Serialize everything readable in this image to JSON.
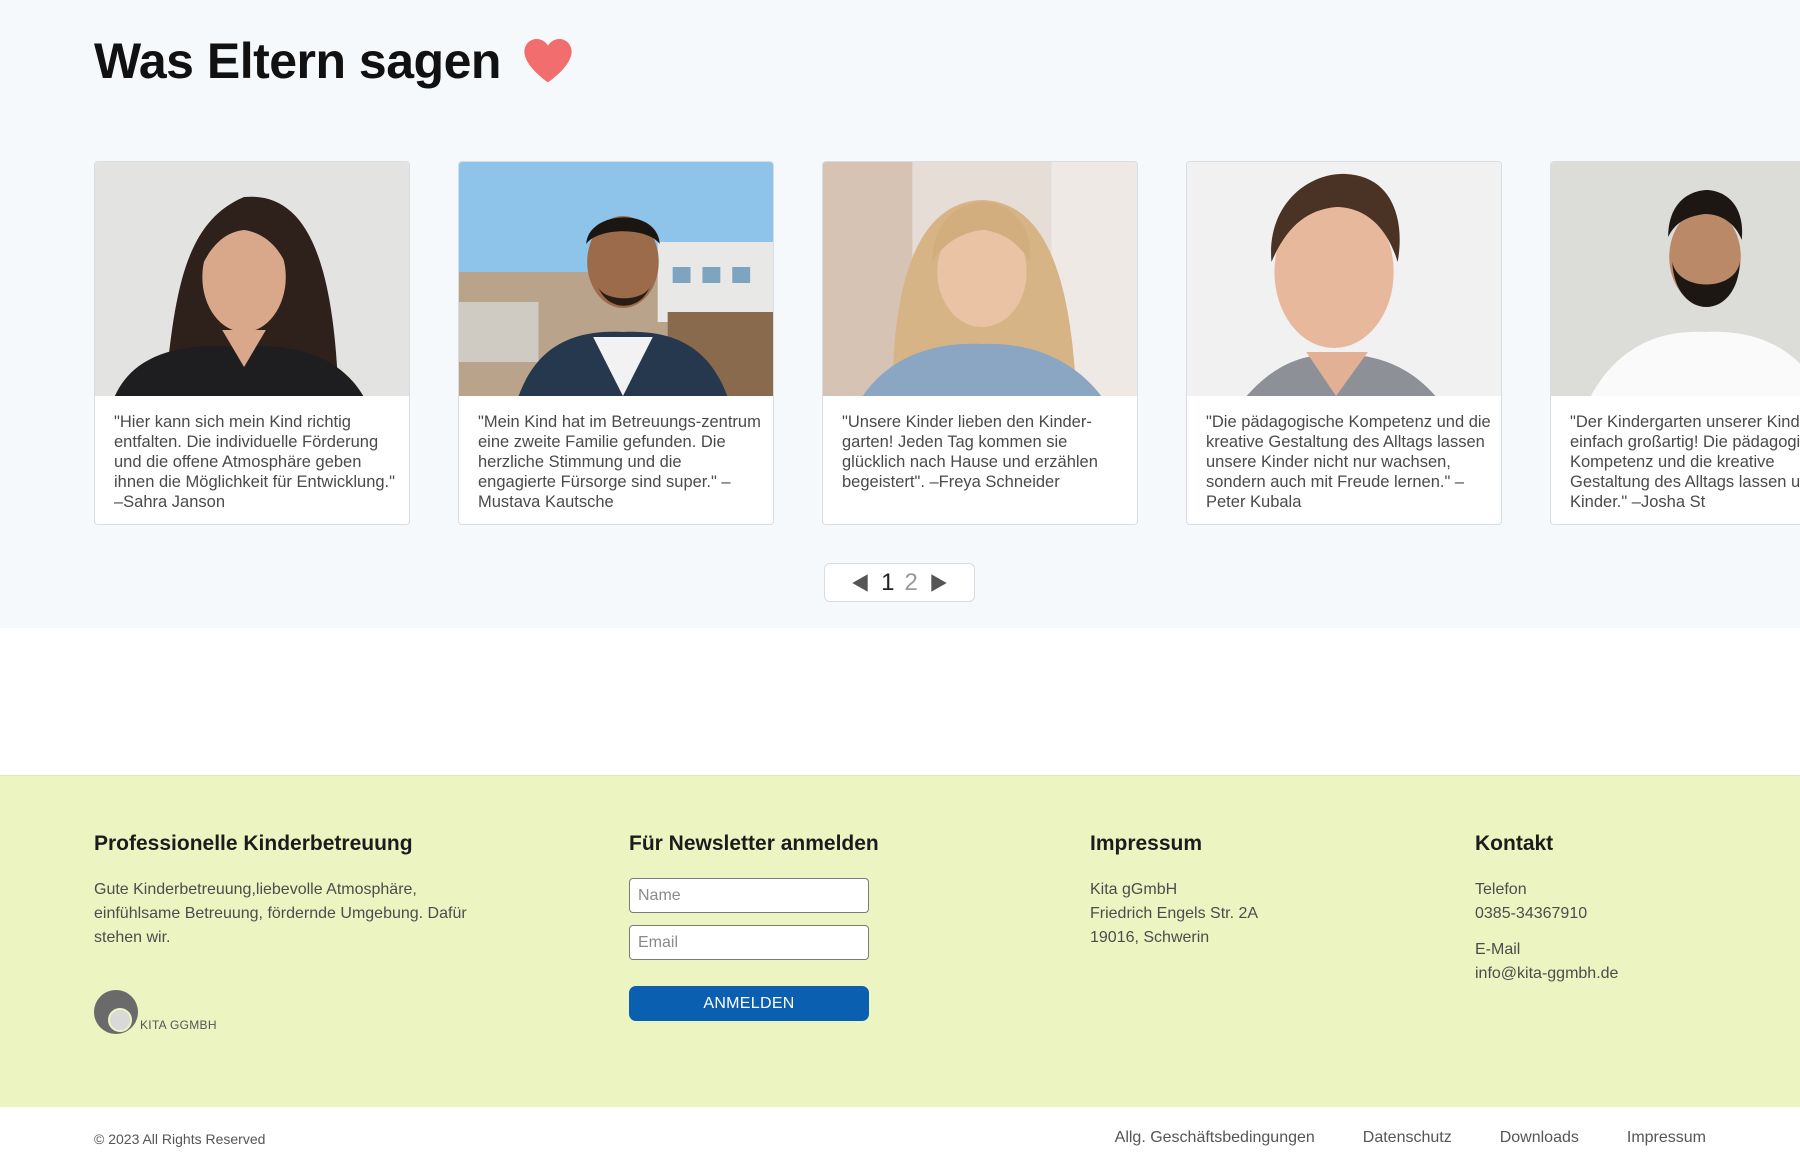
{
  "testimonials": {
    "heading": "Was Eltern sagen",
    "heart_icon": "heart-icon",
    "heart_color": "#f26d6d",
    "cards": [
      {
        "quote": "\"Hier kann sich mein Kind richtig entfalten. Die individuelle Förderung und die offene Atmosphäre geben ihnen die Möglichkeit für Entwicklung.\" –Sahra Janson"
      },
      {
        "quote": "\"Mein Kind hat im Betreuungs-zentrum eine zweite Familie gefunden. Die herzliche Stimmung und die engagierte Fürsorge sind super.\" – Mustava Kautsche"
      },
      {
        "quote": "\"Unsere Kinder lieben den Kinder-garten! Jeden Tag kommen sie glücklich nach Hause und erzählen begeistert\". –Freya Schneider"
      },
      {
        "quote": "\"Die pädagogische Kompetenz und die kreative Gestaltung des Alltags lassen unsere Kinder nicht nur wachsen, sondern auch mit Freude lernen.\" – Peter Kubala"
      },
      {
        "quote": "\"Der Kindergarten unserer Kinder ist einfach großartig! Die pädagogische Kompetenz und die kreative Gestaltung des Alltags lassen unsere Kinder.\" –Josha St"
      }
    ],
    "pager": {
      "prev_icon": "triangle-left-icon",
      "next_icon": "triangle-right-icon",
      "page_1": "1",
      "page_2": "2",
      "current_page": 1
    }
  },
  "footer": {
    "about": {
      "title": "Professionelle Kinderbetreuung",
      "text": "Gute Kinderbetreuung,liebevolle Atmosphäre, einfühlsame Betreuung, fördernde Umgebung. Dafür stehen wir.",
      "logo_text": "KITA GGMBH"
    },
    "newsletter": {
      "title": "Für Newsletter anmelden",
      "name_placeholder": "Name",
      "email_placeholder": "Email",
      "button_label": "ANMELDEN",
      "button_color": "#0b5fb0"
    },
    "impressum": {
      "title": "Impressum",
      "line1": "Kita gGmbH",
      "line2": "Friedrich Engels Str. 2A",
      "line3": "19016, Schwerin"
    },
    "kontakt": {
      "title": "Kontakt",
      "phone_label": "Telefon",
      "phone": "0385-34367910",
      "email_label": "E-Mail",
      "email": "info@kita-ggmbh.de"
    },
    "background_color": "#ecf5c2"
  },
  "bottom": {
    "copyright": "© 2023 All Rights Reserved",
    "links": [
      "Allg. Geschäftsbedingungen",
      "Datenschutz",
      "Downloads",
      "Impressum"
    ]
  }
}
